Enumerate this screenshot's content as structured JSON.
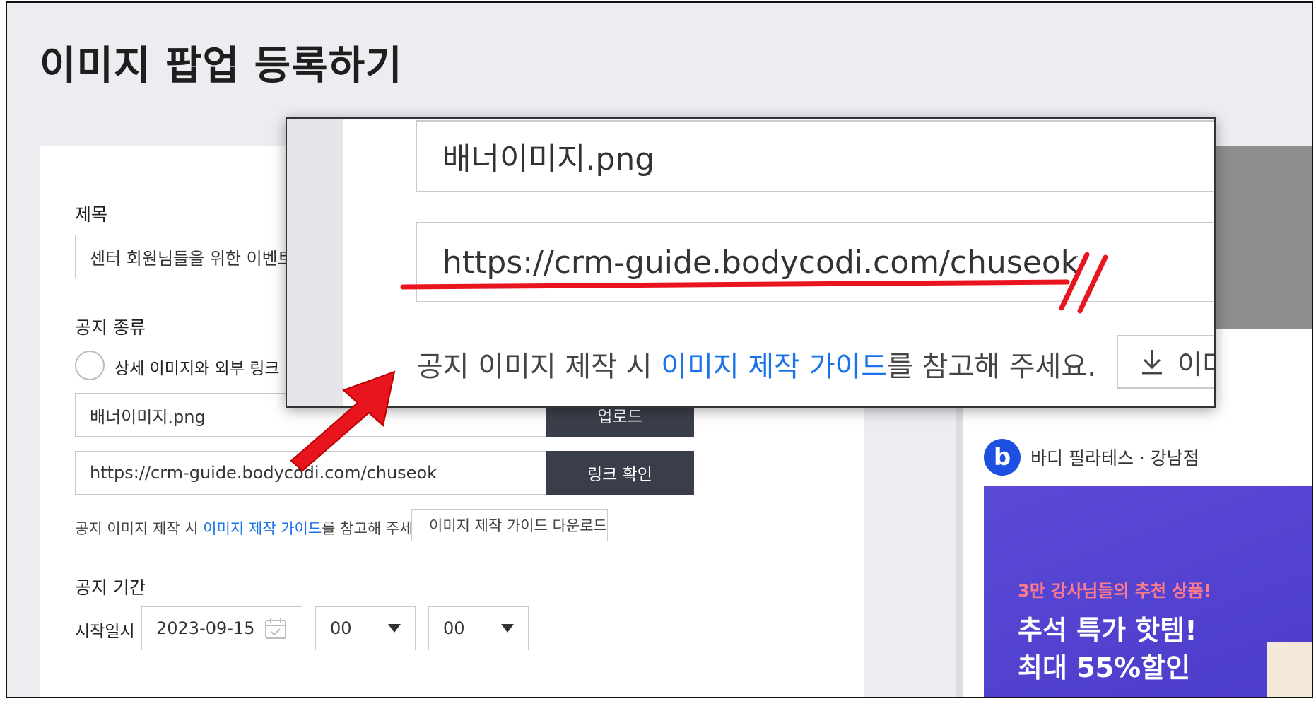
{
  "page": {
    "title": "이미지 팝업 등록하기"
  },
  "form": {
    "title_label": "제목",
    "title_value": "센터 회원님들을 위한 이벤트",
    "type_label": "공지 종류",
    "radio_option": "상세 이미지와 외부 링크",
    "image_file_value": "배너이미지.png",
    "upload_button": "업로드",
    "link_value": "https://crm-guide.bodycodi.com/chuseok",
    "link_check_button": "링크 확인",
    "hint_prefix": "공지 이미지 제작 시 ",
    "hint_link": "이미지 제작 가이드",
    "hint_suffix": "를 참고해 주세요.",
    "guide_download_button": "이미지 제작 가이드 다운로드",
    "period_label": "공지 기간",
    "start_label": "시작일시",
    "start_date": "2023-09-15",
    "start_hour": "00",
    "start_minute": "00"
  },
  "preview": {
    "brand_name": "바디 필라테스 · 강남점",
    "brand_logo_letter": "b",
    "promo_sub": "3만 강사님들의 추천 상품!",
    "promo_line1": "추석 특가 핫템!",
    "promo_line2": "최대 55%할인"
  },
  "zoom": {
    "file_value": "배너이미지.png",
    "link_value": "https://crm-guide.bodycodi.com/chuseok",
    "hint_prefix": "공지 이미지 제작 시 ",
    "hint_link": "이미지 제작 가이드",
    "hint_suffix": "를 참고해 주세요.",
    "button_fragment": "이미"
  },
  "colors": {
    "accent_link": "#1a73e8",
    "dark_button": "#3a3e4a",
    "annotation_red": "#e8141e",
    "promo_bg": "#5a4ad6",
    "brand_blue": "#1d4fe0"
  },
  "icons": [
    "download-icon",
    "calendar-icon",
    "caret-down-icon",
    "arrow-annotation",
    "underline-annotation"
  ]
}
